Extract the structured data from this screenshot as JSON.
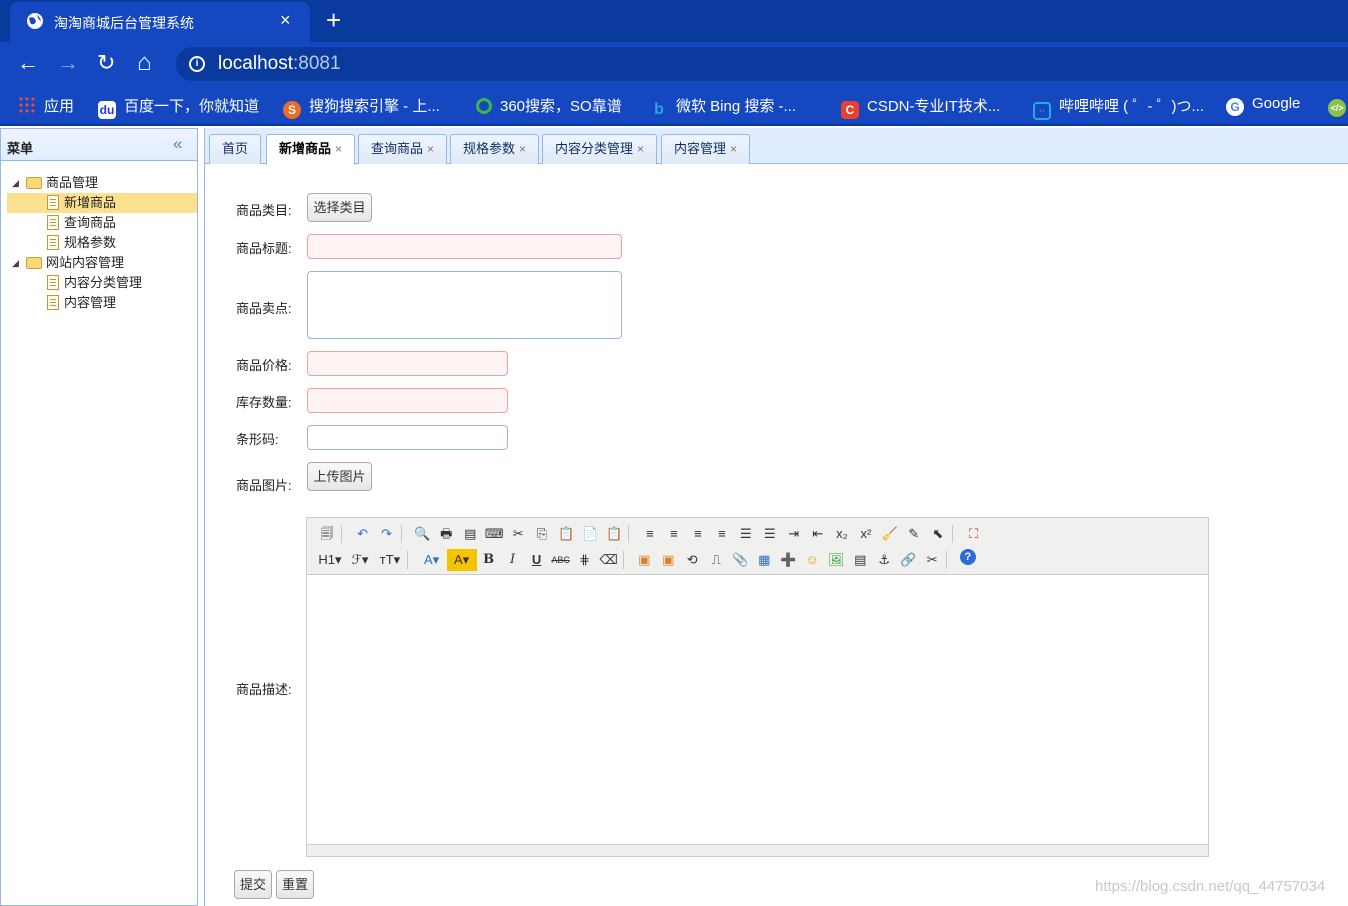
{
  "browser": {
    "tab_title": "淘淘商城后台管理系统",
    "tab_close": "×",
    "new_tab": "+",
    "url_host": "localhost",
    "url_port": ":8081",
    "nav": {
      "back": "←",
      "forward": "→",
      "reload": "↻",
      "home": "⌂"
    },
    "bookmarks": [
      {
        "label": "应用",
        "icon": "apps-grid-icon",
        "color": "#e84b3c"
      },
      {
        "label": "百度一下，你就知道",
        "icon": "baidu-icon",
        "color": "#ffffff"
      },
      {
        "label": "搜狗搜索引擎 - 上...",
        "icon": "sogou-icon",
        "color": "#f06a28"
      },
      {
        "label": "360搜索，SO靠谱",
        "icon": "360-icon",
        "color": "#3cb54a"
      },
      {
        "label": "微软 Bing 搜索 -...",
        "icon": "bing-icon",
        "color": "#2aa6e8"
      },
      {
        "label": "CSDN-专业IT技术...",
        "icon": "csdn-icon",
        "color": "#e8402f"
      },
      {
        "label": "哔哩哔哩 ( ゜- ゜)つ...",
        "icon": "bilibili-icon",
        "color": "#23ade5"
      },
      {
        "label": "Google",
        "icon": "google-icon",
        "color": "#ffffff"
      }
    ]
  },
  "menu": {
    "title": "菜单",
    "collapse": "«",
    "tree": [
      {
        "label": "商品管理",
        "type": "folder",
        "level": 0
      },
      {
        "label": "新增商品",
        "type": "file",
        "level": 1,
        "selected": true
      },
      {
        "label": "查询商品",
        "type": "file",
        "level": 1
      },
      {
        "label": "规格参数",
        "type": "file",
        "level": 1
      },
      {
        "label": "网站内容管理",
        "type": "folder",
        "level": 0
      },
      {
        "label": "内容分类管理",
        "type": "file",
        "level": 1
      },
      {
        "label": "内容管理",
        "type": "file",
        "level": 1
      }
    ]
  },
  "tabs": [
    {
      "label": "首页",
      "closable": false
    },
    {
      "label": "新增商品",
      "closable": true,
      "active": true
    },
    {
      "label": "查询商品",
      "closable": true
    },
    {
      "label": "规格参数",
      "closable": true
    },
    {
      "label": "内容分类管理",
      "closable": true
    },
    {
      "label": "内容管理",
      "closable": true
    }
  ],
  "tab_close": "×",
  "form": {
    "category_label": "商品类目:",
    "category_button": "选择类目",
    "title_label": "商品标题:",
    "sell_point_label": "商品卖点:",
    "price_label": "商品价格:",
    "stock_label": "库存数量:",
    "barcode_label": "条形码:",
    "image_label": "商品图片:",
    "image_button": "上传图片",
    "desc_label": "商品描述:",
    "submit": "提交",
    "reset": "重置"
  },
  "editor": {
    "row1": [
      "🗐",
      "↶",
      "↷",
      "🔍",
      "🖶",
      "▤",
      "⌨",
      "✂",
      "⎘",
      "📋",
      "📄",
      "📋",
      "≡",
      "≡",
      "≡",
      "≡",
      "☰",
      "☰",
      "⇥",
      "⇤",
      "x₂",
      "x²",
      "🧹",
      "✎",
      "⬉",
      "⛶"
    ],
    "row2": [
      "H1▾",
      "ℱ▾",
      "ᴛT▾",
      "A▾",
      "A▾",
      "B",
      "I",
      "U",
      "ABC",
      "⋕",
      "⌫",
      "▣",
      "▣",
      "⟲",
      "⎍",
      "📎",
      "▦",
      "➕",
      "☺",
      "🖼",
      "▤",
      "⚓",
      "🔗",
      "✂",
      "?"
    ]
  },
  "watermark": "https://blog.csdn.net/qq_44757034",
  "colors": {
    "accent": "#95b8e7",
    "chrome": "#1447c0",
    "selected": "#fbe08f"
  }
}
